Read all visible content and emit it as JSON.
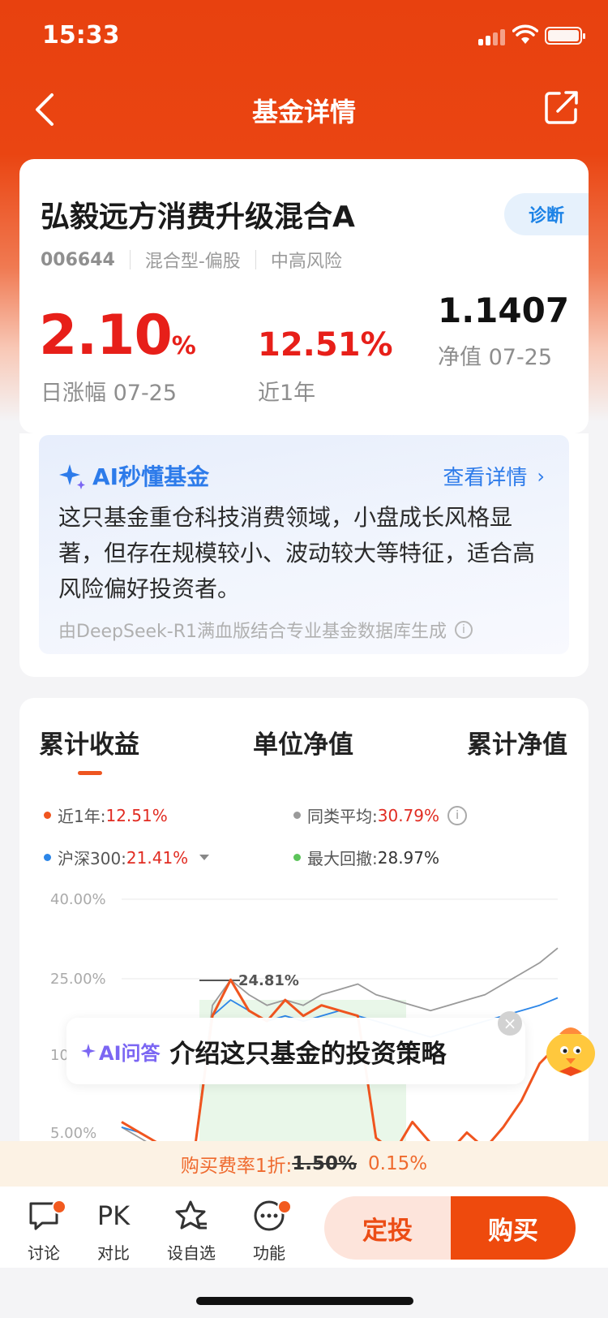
{
  "status_bar": {
    "time": "15:33"
  },
  "nav": {
    "title": "基金详情"
  },
  "fund": {
    "name": "弘毅远方消费升级混合A",
    "code": "006644",
    "type": "混合型-偏股",
    "risk": "中高风险",
    "diagnose_label": "诊断",
    "daily_change": "2.10",
    "daily_change_unit": "%",
    "daily_change_label": "日涨幅 07-25",
    "year_change": "12.51%",
    "year_change_label": "近1年",
    "nav_value": "1.1407",
    "nav_label": "净值 07-25"
  },
  "ai_summary": {
    "title": "AI秒懂基金",
    "more_label": "查看详情",
    "text": "这只基金重仓科技消费领域，小盘成长风格显著，但存在规模较小、波动较大等特征，适合高风险偏好投资者。",
    "footnote": "由DeepSeek-R1满血版结合专业基金数据库生成"
  },
  "chart_tabs": [
    "累计收益",
    "单位净值",
    "累计净值"
  ],
  "legend": {
    "near_year": {
      "label": "近1年:",
      "value": "12.51%",
      "color": "#f0551f"
    },
    "peer_avg": {
      "label": "同类平均:",
      "value": "30.79%",
      "color": "#9a9a9a"
    },
    "hs300": {
      "label": "沪深300:",
      "value": "21.41%",
      "color": "#2c86e8"
    },
    "max_drawdown": {
      "label": "最大回撤:",
      "value": "28.97%",
      "color": "#5cc45a"
    }
  },
  "chart_data": {
    "type": "line",
    "y_ticks": [
      "40.00%",
      "25.00%",
      "10",
      "5.00%"
    ],
    "annotation": "24.81%",
    "series": [
      {
        "name": "近1年",
        "values": [
          -2,
          -4,
          -6,
          -10,
          -11,
          18,
          24.8,
          19,
          17,
          21,
          18,
          20,
          19,
          18,
          -5,
          -8,
          -2,
          -6,
          -9,
          -4,
          -7,
          -3,
          2,
          9,
          12.51
        ]
      },
      {
        "name": "同类平均",
        "values": [
          -3,
          -5,
          -7,
          -10,
          -11,
          20,
          24.8,
          22,
          20,
          21,
          20,
          22,
          23,
          24,
          22,
          21,
          20,
          19,
          20,
          21,
          22,
          24,
          26,
          28,
          30.79
        ]
      },
      {
        "name": "沪深300",
        "values": [
          -3,
          -4,
          -6,
          -9,
          -10,
          18,
          21,
          19,
          17,
          18,
          17,
          18,
          19,
          18,
          17,
          16,
          15,
          14,
          15,
          16,
          17,
          18,
          19,
          20,
          21.41
        ]
      },
      {
        "name": "最大回撤",
        "values": []
      }
    ]
  },
  "ask_bubble": {
    "tag": "AI问答",
    "text": "介绍这只基金的投资策略"
  },
  "fee": {
    "prefix": "购买费率1折:",
    "old_rate": "1.50%",
    "new_rate": "0.15%"
  },
  "bottom_bar": {
    "discuss": "讨论",
    "pk_icon": "PK",
    "compare": "对比",
    "watchlist": "设自选",
    "functions": "功能",
    "sip": "定投",
    "buy": "购买"
  }
}
